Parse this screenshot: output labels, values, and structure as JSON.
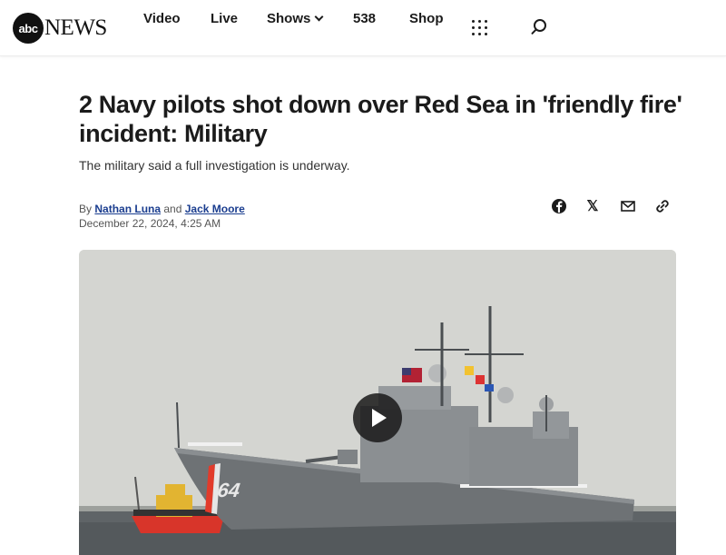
{
  "header": {
    "logo_abc": "abc",
    "logo_news": "NEWS",
    "nav": {
      "video": "Video",
      "live": "Live",
      "shows": "Shows",
      "fivethirtyeight": "538",
      "shop": "Shop"
    },
    "icons": [
      "grid-menu-icon",
      "search-icon"
    ]
  },
  "article": {
    "headline": "2 Navy pilots shot down over Red Sea in 'friendly fire' incident: Military",
    "subheadline": "The military said a full investigation is underway.",
    "byline_prefix": "By",
    "author1": "Nathan Luna",
    "byline_and": "and",
    "author2": "Jack Moore",
    "date": "December 22, 2024, 4:25 AM",
    "share_icons": [
      "facebook-icon",
      "x-icon",
      "mail-icon",
      "link-icon"
    ]
  },
  "hero": {
    "hull_number": "64",
    "media": "video-thumbnail",
    "colors": {
      "hull": "#6e7275",
      "tug": "#d8352a",
      "water": "#5f6467"
    }
  }
}
